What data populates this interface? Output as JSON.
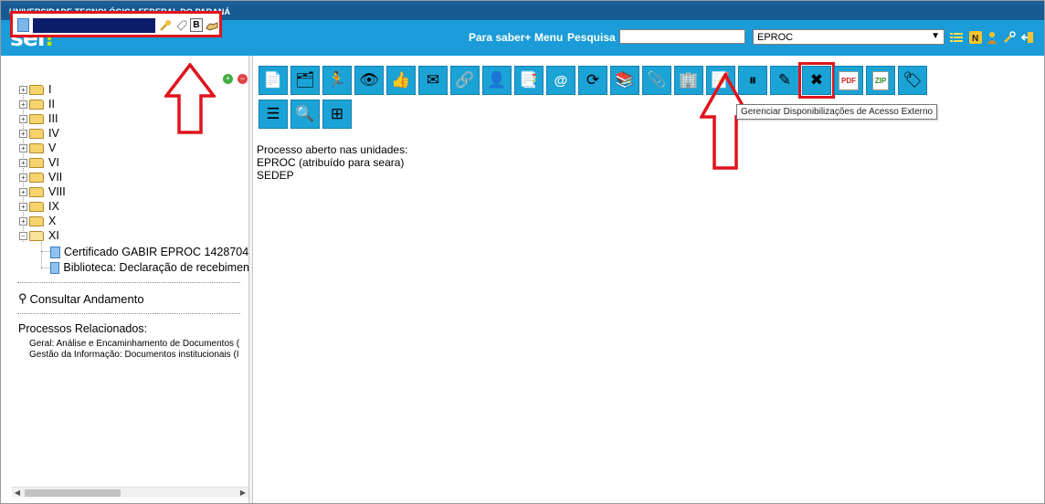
{
  "header": {
    "institution": "UNIVERSIDADE TECNOLÓGICA FEDERAL DO PARANÁ",
    "logo_text": "sei",
    "logo_mark": "!",
    "links": [
      "Para saber+",
      "Menu",
      "Pesquisa"
    ],
    "search_value": "",
    "unit_selected": "EPROC",
    "icons": [
      "list-icon",
      "notification-icon",
      "user-icon",
      "tools-icon",
      "logout-icon"
    ]
  },
  "process_header": {
    "number_redacted": true,
    "badge_label": "B",
    "icons": [
      "process-doc-icon",
      "key-icon",
      "tag-icon",
      "signature-hand-icon",
      "add-icon",
      "remove-icon"
    ]
  },
  "tree": {
    "folders": [
      {
        "label": "I",
        "expanded": false
      },
      {
        "label": "II",
        "expanded": false
      },
      {
        "label": "III",
        "expanded": false
      },
      {
        "label": "IV",
        "expanded": false
      },
      {
        "label": "V",
        "expanded": false
      },
      {
        "label": "VI",
        "expanded": false
      },
      {
        "label": "VII",
        "expanded": false
      },
      {
        "label": "VIII",
        "expanded": false
      },
      {
        "label": "IX",
        "expanded": false
      },
      {
        "label": "X",
        "expanded": false
      },
      {
        "label": "XI",
        "expanded": true
      }
    ],
    "documents": [
      {
        "label": "Certificado GABIR EPROC 1428704"
      },
      {
        "label": "Biblioteca: Declaração de recebimen"
      }
    ]
  },
  "consult_link": "Consultar Andamento",
  "related": {
    "title": "Processos Relacionados:",
    "items": [
      "Geral: Análise e Encaminhamento de Documentos (",
      "Gestão da Informação: Documentos institucionais (I"
    ]
  },
  "toolbar": {
    "selected_index": 17,
    "tooltip": "Gerenciar Disponibilizações de Acesso Externo",
    "buttons": [
      "include-document-icon",
      "start-related-process-icon",
      "send-process-icon",
      "follow-up-icon",
      "conclude-process-icon",
      "create-block-icon",
      "relate-process-icon",
      "assign-process-icon",
      "duplicate-process-icon",
      "send-email-icon",
      "update-andamento-icon",
      "archive-icon",
      "attach-process-icon",
      "external-access-icon",
      "annotations-icon",
      "suspend-process-icon",
      "edit-process-icon",
      "cancel-process-icon",
      "generate-pdf-icon",
      "generate-zip-icon",
      "markers-icon",
      "list-view-icon",
      "search-in-process-icon",
      "tree-view-icon"
    ]
  },
  "process_info": {
    "title": "Processo aberto nas unidades:",
    "units": [
      "EPROC (atribuído para seara)",
      "SEDEP"
    ]
  },
  "colors": {
    "header_blue": "#1b9cd8",
    "institution_bar": "#155a93",
    "highlight_red": "#e0141c",
    "button_blue": "#1ba3d6"
  }
}
